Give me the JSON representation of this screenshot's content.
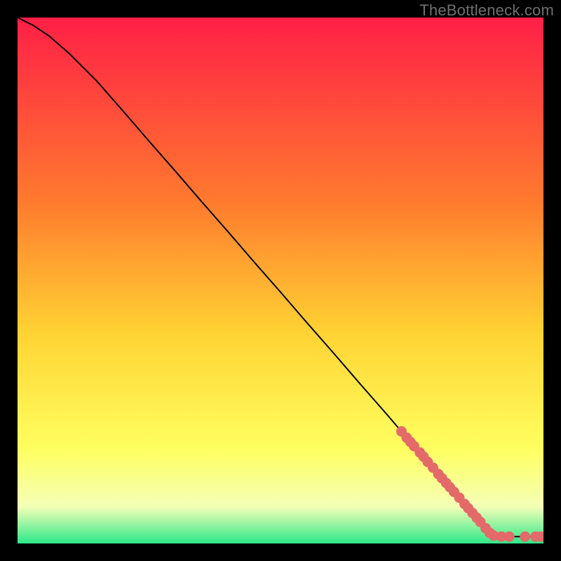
{
  "watermark": "TheBottleneck.com",
  "colors": {
    "background_top": "#ff1f47",
    "background_mid1": "#ff7a2e",
    "background_mid2": "#ffd333",
    "background_mid3": "#ffff60",
    "background_mid4": "#f4ffb6",
    "background_low": "#2ee88a",
    "curve": "#000000",
    "markers": "#e46a6a"
  },
  "chart_data": {
    "type": "line",
    "title": "",
    "xlabel": "",
    "ylabel": "",
    "xlim": [
      0,
      100
    ],
    "ylim": [
      0,
      100
    ],
    "series": [
      {
        "name": "bottleneck-curve",
        "x": [
          0,
          3,
          6,
          10,
          15,
          20,
          25,
          30,
          35,
          40,
          45,
          50,
          55,
          60,
          65,
          70,
          73,
          76,
          79,
          81,
          82.5,
          84,
          85.5,
          87,
          88.5,
          90,
          92,
          94,
          96,
          98,
          100
        ],
        "y": [
          100,
          98.5,
          96.5,
          93,
          88,
          82.3,
          76.5,
          70.8,
          65.0,
          59.3,
          53.5,
          47.8,
          42.0,
          36.3,
          30.5,
          24.8,
          21.3,
          17.9,
          14.4,
          12.1,
          10.4,
          8.7,
          6.9,
          5.2,
          3.5,
          1.8,
          1.3,
          1.3,
          1.3,
          1.3,
          1.3
        ]
      }
    ],
    "markers": {
      "name": "highlight-points",
      "x": [
        73,
        74,
        74.7,
        75.4,
        76.5,
        77.2,
        78,
        79,
        80,
        80.7,
        81.5,
        82.2,
        83,
        84,
        85,
        85.7,
        86.5,
        87.3,
        88,
        89,
        89.8,
        90.5,
        92,
        93.5,
        96.5,
        98.5,
        99.5
      ],
      "y": [
        21.3,
        20.1,
        19.3,
        18.5,
        17.3,
        16.5,
        15.5,
        14.4,
        13.2,
        12.4,
        11.5,
        10.7,
        9.8,
        8.7,
        7.5,
        6.7,
        5.8,
        4.9,
        4.1,
        2.9,
        2.0,
        1.5,
        1.3,
        1.3,
        1.3,
        1.3,
        1.3
      ]
    },
    "gradient_stops": [
      {
        "offset": 0.0,
        "key": "background_top"
      },
      {
        "offset": 0.35,
        "key": "background_mid1"
      },
      {
        "offset": 0.6,
        "key": "background_mid2"
      },
      {
        "offset": 0.82,
        "key": "background_mid3"
      },
      {
        "offset": 0.93,
        "key": "background_mid4"
      },
      {
        "offset": 1.0,
        "key": "background_low"
      }
    ]
  }
}
